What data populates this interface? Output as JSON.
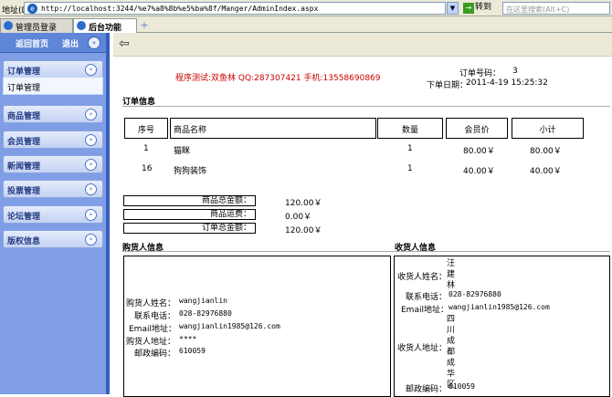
{
  "browser": {
    "address_label": "地址(D)",
    "url": "http://localhost:3244/%e7%a8%8b%e5%ba%8f/Manger/AdminIndex.aspx",
    "go_label": "转到",
    "search_placeholder": "在这里搜索(Alt+C)",
    "tabs": [
      {
        "label": "管理员登录"
      },
      {
        "label": "后台功能"
      }
    ]
  },
  "sidebar": {
    "home_label": "返回首页",
    "logout_label": "退出",
    "menus": [
      {
        "label": "订单管理"
      },
      {
        "label": "商品管理"
      },
      {
        "label": "会员管理"
      },
      {
        "label": "新闻管理"
      },
      {
        "label": "投票管理"
      },
      {
        "label": "论坛管理"
      },
      {
        "label": "版权信息"
      }
    ],
    "submenu": "订单管理"
  },
  "order": {
    "contact": "程序测试:双鱼林 QQ:287307421 手机:13558690869",
    "order_no_label": "订单号码：",
    "order_no": "3",
    "date_label": "下单日期：",
    "date": "2011-4-19 15:25:32",
    "section_title": "订单信息",
    "columns": [
      "序号",
      "商品名称",
      "数量",
      "会员价",
      "小计"
    ],
    "items": [
      {
        "no": "1",
        "name": "猫眯",
        "qty": "1",
        "price": "80.00￥",
        "subtotal": "80.00￥"
      },
      {
        "no": "16",
        "name": "狗狗装饰",
        "qty": "1",
        "price": "40.00￥",
        "subtotal": "40.00￥"
      }
    ],
    "totals": [
      {
        "label": "商品总金额：",
        "value": "120.00￥"
      },
      {
        "label": "商品运费：",
        "value": "0.00￥"
      },
      {
        "label": "订单总金额：",
        "value": "120.00￥"
      }
    ]
  },
  "buyer": {
    "title": "购货人信息",
    "fields": [
      {
        "label": "购货人姓名：",
        "value": "wangjianlin"
      },
      {
        "label": "联系电话：",
        "value": "028-82976880"
      },
      {
        "label": "Email地址：",
        "value": "wangjianlin1985@126.com"
      },
      {
        "label": "购货人地址：",
        "value": "****"
      },
      {
        "label": "邮政编码：",
        "value": "610059"
      }
    ]
  },
  "receiver": {
    "title": "收货人信息",
    "fields": [
      {
        "label": "收货人姓名：",
        "value": "汪建林"
      },
      {
        "label": "联系电话：",
        "value": "028-82976880"
      },
      {
        "label": "Email地址：",
        "value": "wangjianlin1985@126.com"
      },
      {
        "label": "收货人地址：",
        "value": "四川成都成华区"
      },
      {
        "label": "邮政编码：",
        "value": "610059"
      }
    ]
  }
}
